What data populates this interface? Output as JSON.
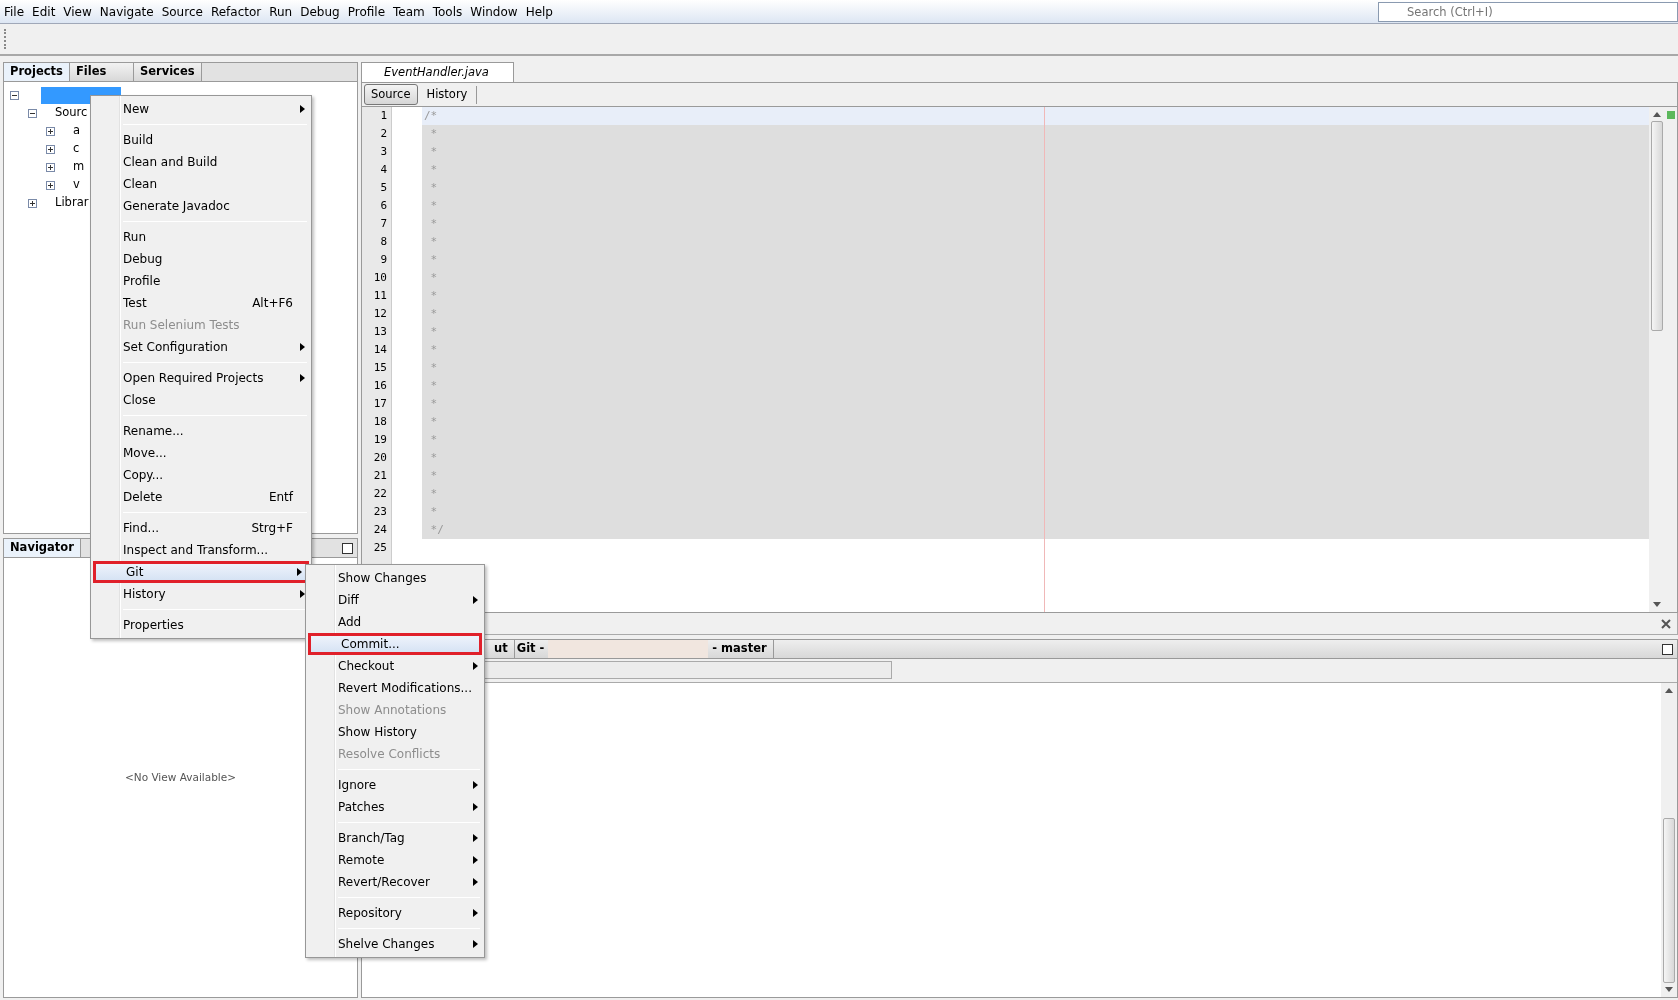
{
  "menubar": {
    "items": [
      "File",
      "Edit",
      "View",
      "Navigate",
      "Source",
      "Refactor",
      "Run",
      "Debug",
      "Profile",
      "Team",
      "Tools",
      "Window",
      "Help"
    ],
    "search": {
      "placeholder": "Search (Ctrl+I)"
    }
  },
  "projects_panel": {
    "tabs": [
      {
        "label": "Projects",
        "selected": true
      },
      {
        "label": "Files",
        "selected": false
      },
      {
        "label": "Services",
        "selected": false
      }
    ],
    "tree": [
      {
        "selected": true,
        "expanded": true,
        "children": [
          {
            "label": "Sourc",
            "selected": false,
            "expanded": true,
            "children": [
              {
                "label": "a",
                "selected": false,
                "expanded": false
              },
              {
                "label": "c",
                "selected": false,
                "expanded": false
              },
              {
                "label": "m",
                "selected": false,
                "expanded": false
              },
              {
                "label": "v",
                "selected": false,
                "expanded": false
              }
            ]
          },
          {
            "label": "Librar",
            "selected": false,
            "expanded": false
          }
        ]
      }
    ]
  },
  "editor": {
    "tab": {
      "title": "EventHandler.java"
    },
    "view_buttons": [
      {
        "label": "Source",
        "selected": true
      },
      {
        "label": "History",
        "selected": false
      }
    ],
    "lines": [
      {
        "number": "1",
        "text": "/*"
      },
      {
        "number": "2",
        "text": " *"
      },
      {
        "number": "3",
        "text": " *"
      },
      {
        "number": "4",
        "text": " *"
      },
      {
        "number": "5",
        "text": " *"
      },
      {
        "number": "6",
        "text": " *"
      },
      {
        "number": "7",
        "text": " *"
      },
      {
        "number": "8",
        "text": " *"
      },
      {
        "number": "9",
        "text": " *"
      },
      {
        "number": "10",
        "text": " *"
      },
      {
        "number": "11",
        "text": " *"
      },
      {
        "number": "12",
        "text": " *"
      },
      {
        "number": "13",
        "text": " *"
      },
      {
        "number": "14",
        "text": " *"
      },
      {
        "number": "15",
        "text": " *"
      },
      {
        "number": "16",
        "text": " *"
      },
      {
        "number": "17",
        "text": " *"
      },
      {
        "number": "18",
        "text": " *"
      },
      {
        "number": "19",
        "text": " *"
      },
      {
        "number": "20",
        "text": " *"
      },
      {
        "number": "21",
        "text": " *"
      },
      {
        "number": "22",
        "text": " *"
      },
      {
        "number": "23",
        "text": " *"
      },
      {
        "number": "24",
        "text": " */"
      },
      {
        "number": "25"
      }
    ]
  },
  "navigator": {
    "title": "Navigator",
    "message": "<No View Available>"
  },
  "output_panel": {
    "tabs": [
      {
        "label": "ut"
      },
      {
        "label": "Git -",
        "label_end": "- master"
      }
    ]
  },
  "context_menu": {
    "items": [
      {
        "kind": "item",
        "label": "New",
        "submenu": true,
        "disabled": false,
        "selected": false
      },
      {
        "kind": "separator"
      },
      {
        "kind": "item",
        "label": "Build",
        "submenu": false,
        "disabled": false,
        "selected": false
      },
      {
        "kind": "item",
        "label": "Clean and Build",
        "submenu": false,
        "disabled": false,
        "selected": false
      },
      {
        "kind": "item",
        "label": "Clean",
        "submenu": false,
        "disabled": false,
        "selected": false
      },
      {
        "kind": "item",
        "label": "Generate Javadoc",
        "submenu": false,
        "disabled": false,
        "selected": false
      },
      {
        "kind": "separator"
      },
      {
        "kind": "item",
        "label": "Run",
        "submenu": false,
        "disabled": false,
        "selected": false
      },
      {
        "kind": "item",
        "label": "Debug",
        "submenu": false,
        "disabled": false,
        "selected": false
      },
      {
        "kind": "item",
        "label": "Profile",
        "submenu": false,
        "disabled": false,
        "selected": false
      },
      {
        "kind": "item",
        "label": "Test",
        "shortcut": "Alt+F6",
        "submenu": false,
        "disabled": false,
        "selected": false
      },
      {
        "kind": "item",
        "label": "Run Selenium Tests",
        "submenu": false,
        "disabled": true,
        "selected": false
      },
      {
        "kind": "item",
        "label": "Set Configuration",
        "submenu": true,
        "disabled": false,
        "selected": false
      },
      {
        "kind": "separator"
      },
      {
        "kind": "item",
        "label": "Open Required Projects",
        "submenu": true,
        "disabled": false,
        "selected": false
      },
      {
        "kind": "item",
        "label": "Close",
        "submenu": false,
        "disabled": false,
        "selected": false
      },
      {
        "kind": "separator"
      },
      {
        "kind": "item",
        "label": "Rename...",
        "submenu": false,
        "disabled": false,
        "selected": false
      },
      {
        "kind": "item",
        "label": "Move...",
        "submenu": false,
        "disabled": false,
        "selected": false
      },
      {
        "kind": "item",
        "label": "Copy...",
        "submenu": false,
        "disabled": false,
        "selected": false
      },
      {
        "kind": "item",
        "label": "Delete",
        "shortcut": "Entf",
        "submenu": false,
        "disabled": false,
        "selected": false
      },
      {
        "kind": "separator"
      },
      {
        "kind": "item",
        "label": "Find...",
        "shortcut": "Strg+F",
        "submenu": false,
        "disabled": false,
        "selected": false
      },
      {
        "kind": "item",
        "label": "Inspect and Transform...",
        "submenu": false,
        "disabled": false,
        "selected": false
      },
      {
        "kind": "item",
        "label": "Git",
        "submenu": true,
        "disabled": false,
        "selected": true
      },
      {
        "kind": "item",
        "label": "History",
        "submenu": true,
        "disabled": false,
        "selected": false
      },
      {
        "kind": "separator"
      },
      {
        "kind": "item",
        "label": "Properties",
        "submenu": false,
        "disabled": false,
        "selected": false
      }
    ]
  },
  "git_submenu": {
    "items": [
      {
        "kind": "item",
        "label": "Show Changes",
        "submenu": false,
        "disabled": false,
        "selected": false
      },
      {
        "kind": "item",
        "label": "Diff",
        "submenu": true,
        "disabled": false,
        "selected": false
      },
      {
        "kind": "item",
        "label": "Add",
        "submenu": false,
        "disabled": false,
        "selected": false
      },
      {
        "kind": "item",
        "label": "Commit...",
        "submenu": false,
        "disabled": false,
        "selected": true
      },
      {
        "kind": "item",
        "label": "Checkout",
        "submenu": true,
        "disabled": false,
        "selected": false
      },
      {
        "kind": "item",
        "label": "Revert Modifications...",
        "submenu": false,
        "disabled": false,
        "selected": false
      },
      {
        "kind": "item",
        "label": "Show Annotations",
        "submenu": false,
        "disabled": true,
        "selected": false
      },
      {
        "kind": "item",
        "label": "Show History",
        "submenu": false,
        "disabled": false,
        "selected": false
      },
      {
        "kind": "item",
        "label": "Resolve Conflicts",
        "submenu": false,
        "disabled": true,
        "selected": false
      },
      {
        "kind": "separator"
      },
      {
        "kind": "item",
        "label": "Ignore",
        "submenu": true,
        "disabled": false,
        "selected": false
      },
      {
        "kind": "item",
        "label": "Patches",
        "submenu": true,
        "disabled": false,
        "selected": false
      },
      {
        "kind": "separator"
      },
      {
        "kind": "item",
        "label": "Branch/Tag",
        "submenu": true,
        "disabled": false,
        "selected": false
      },
      {
        "kind": "item",
        "label": "Remote",
        "submenu": true,
        "disabled": false,
        "selected": false
      },
      {
        "kind": "item",
        "label": "Revert/Recover",
        "submenu": true,
        "disabled": false,
        "selected": false
      },
      {
        "kind": "separator"
      },
      {
        "kind": "item",
        "label": "Repository",
        "submenu": true,
        "disabled": false,
        "selected": false
      },
      {
        "kind": "separator"
      },
      {
        "kind": "item",
        "label": "Shelve Changes",
        "submenu": true,
        "disabled": false,
        "selected": false
      }
    ]
  }
}
